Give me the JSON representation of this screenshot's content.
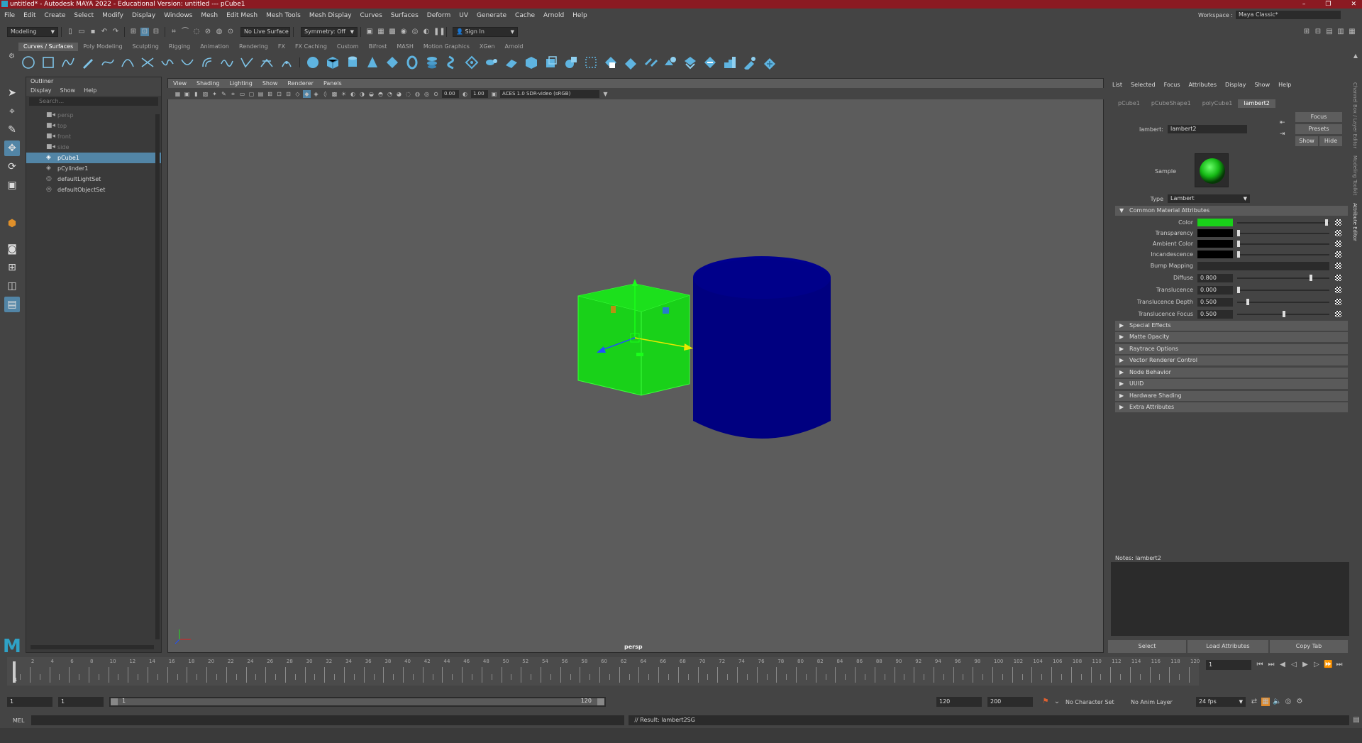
{
  "titlebar": {
    "title": "untitled* - Autodesk MAYA 2022 - Educational Version: untitled  ---  pCube1"
  },
  "menubar": [
    "File",
    "Edit",
    "Create",
    "Select",
    "Modify",
    "Display",
    "Windows",
    "Mesh",
    "Edit Mesh",
    "Mesh Tools",
    "Mesh Display",
    "Curves",
    "Surfaces",
    "Deform",
    "UV",
    "Generate",
    "Cache",
    "Arnold",
    "Help"
  ],
  "workspace": {
    "label": "Workspace :",
    "value": "Maya Classic*"
  },
  "statusline": {
    "menuset": "Modeling",
    "live_surface": "No Live Surface",
    "symmetry": "Symmetry: Off",
    "sign_in": "Sign In"
  },
  "shelf_tabs": [
    "Curves / Surfaces",
    "Poly Modeling",
    "Sculpting",
    "Rigging",
    "Animation",
    "Rendering",
    "FX",
    "FX Caching",
    "Custom",
    "Bifrost",
    "MASH",
    "Motion Graphics",
    "XGen",
    "Arnold"
  ],
  "outliner": {
    "title": "Outliner",
    "menu": [
      "Display",
      "Show",
      "Help"
    ],
    "search_placeholder": "Search...",
    "items": [
      {
        "label": "persp",
        "icon": "camera-icon",
        "dim": true
      },
      {
        "label": "top",
        "icon": "camera-icon",
        "dim": true
      },
      {
        "label": "front",
        "icon": "camera-icon",
        "dim": true
      },
      {
        "label": "side",
        "icon": "camera-icon",
        "dim": true
      },
      {
        "label": "pCube1",
        "icon": "mesh-icon",
        "selected": true
      },
      {
        "label": "pCylinder1",
        "icon": "mesh-icon"
      },
      {
        "label": "defaultLightSet",
        "icon": "set-icon"
      },
      {
        "label": "defaultObjectSet",
        "icon": "set-icon"
      }
    ]
  },
  "viewport": {
    "menu": [
      "View",
      "Shading",
      "Lighting",
      "Show",
      "Renderer",
      "Panels"
    ],
    "exposure": "0.00",
    "gamma": "1.00",
    "color_space": "ACES 1.0 SDR-video (sRGB)",
    "camera": "persp"
  },
  "attribute_editor": {
    "menu": [
      "List",
      "Selected",
      "Focus",
      "Attributes",
      "Display",
      "Show",
      "Help"
    ],
    "tabs": [
      "pCube1",
      "pCubeShape1",
      "polyCube1",
      "lambert2"
    ],
    "active_tab": "lambert2",
    "node_type_label": "lambert:",
    "node_name": "lambert2",
    "focus": "Focus",
    "presets": "Presets",
    "show": "Show",
    "hide": "Hide",
    "sample_label": "Sample",
    "type_label": "Type",
    "type_value": "Lambert",
    "common_section": "Common Material Attributes",
    "attrs": [
      {
        "label": "Color",
        "swatch": "#19d119",
        "slider": 0.97
      },
      {
        "label": "Transparency",
        "swatch": "#000000",
        "slider": 0.0
      },
      {
        "label": "Ambient Color",
        "swatch": "#000000",
        "slider": 0.0
      },
      {
        "label": "Incandescence",
        "swatch": "#000000",
        "slider": 0.0
      },
      {
        "label": "Bump Mapping"
      },
      {
        "label": "Diffuse",
        "value": "0.800",
        "slider": 0.8
      },
      {
        "label": "Translucence",
        "value": "0.000",
        "slider": 0.0
      },
      {
        "label": "Translucence Depth",
        "value": "0.500",
        "slider": 0.1
      },
      {
        "label": "Translucence Focus",
        "value": "0.500",
        "slider": 0.5
      }
    ],
    "collapsed_sections": [
      "Special Effects",
      "Matte Opacity",
      "Raytrace Options",
      "Vector Renderer Control",
      "Node Behavior",
      "UUID",
      "Hardware Shading",
      "Extra Attributes"
    ],
    "notes_label": "Notes:  lambert2",
    "buttons": [
      "Select",
      "Load Attributes",
      "Copy Tab"
    ],
    "vertical_tabs": [
      "Channel Box / Layer Editor",
      "Modeling Toolkit",
      "Attribute Editor"
    ]
  },
  "timeline": {
    "ticks": [
      "2",
      "4",
      "6",
      "8",
      "10",
      "12",
      "14",
      "16",
      "18",
      "20",
      "22",
      "24",
      "26",
      "28",
      "30",
      "32",
      "34",
      "36",
      "38",
      "40",
      "42",
      "44",
      "46",
      "48",
      "50",
      "52",
      "54",
      "56",
      "58",
      "60",
      "62",
      "64",
      "66",
      "68",
      "70",
      "72",
      "74",
      "76",
      "78",
      "80",
      "82",
      "84",
      "86",
      "88",
      "90",
      "92",
      "94",
      "96",
      "98",
      "100",
      "102",
      "104",
      "106",
      "108",
      "110",
      "112",
      "114",
      "116",
      "118",
      "120"
    ],
    "current_frame": "1",
    "current_frame_marker": "1"
  },
  "range": {
    "start": "1",
    "playback_start": "1",
    "slider_start": "1",
    "slider_end": "120",
    "playback_end": "120",
    "end": "200",
    "character_set": "No Character Set",
    "anim_layer": "No Anim Layer",
    "fps": "24 fps"
  },
  "cmdline": {
    "mode": "MEL",
    "result": "// Result: lambert2SG"
  },
  "colors": {
    "accent": "#5285a6",
    "cube": "#19d119",
    "cylinder": "#000080",
    "titlebar": "#8b1a22"
  }
}
